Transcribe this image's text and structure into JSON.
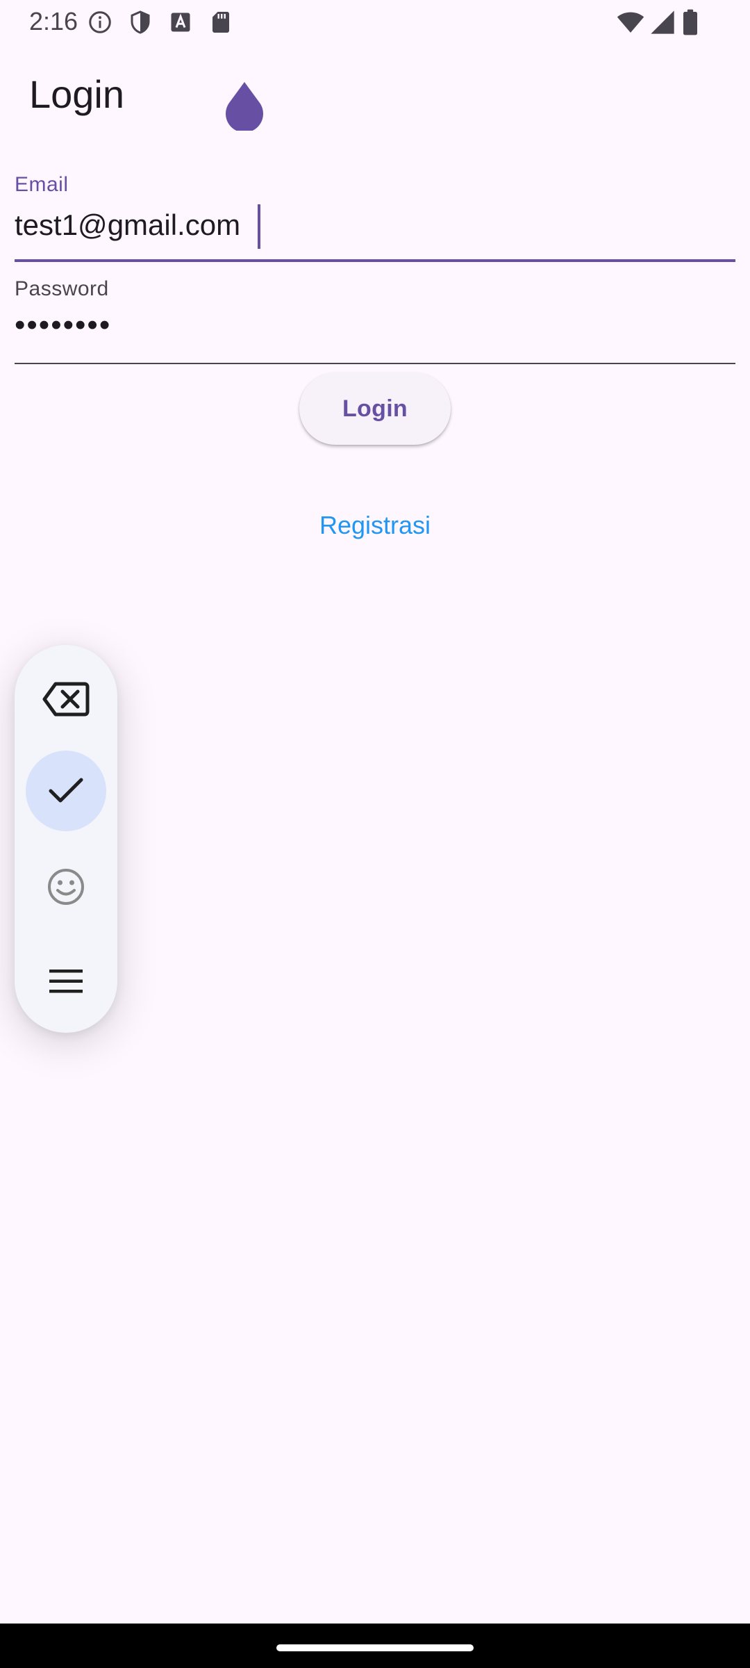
{
  "status_bar": {
    "time": "2:16",
    "left_icons": [
      "info-icon",
      "shield-icon",
      "font-a-icon",
      "sd-card-icon"
    ],
    "right_icons": [
      "wifi-icon",
      "cell-signal-icon",
      "battery-icon"
    ]
  },
  "app_bar": {
    "title": "Login"
  },
  "form": {
    "email": {
      "label": "Email",
      "value": "test1@gmail.com"
    },
    "password": {
      "label": "Password",
      "value": "••••••••"
    },
    "login_button": "Login",
    "register_link": "Registrasi"
  },
  "keyboard_toolbar": {
    "buttons": [
      "backspace-icon",
      "check-icon",
      "emoji-icon",
      "menu-icon"
    ],
    "active": "check-icon"
  },
  "colors": {
    "background": "#FEF7FF",
    "primary": "#6750A4",
    "link": "#2196F3",
    "toolbar_bg": "#F4F5FB",
    "toolbar_active": "#D8E2FB"
  }
}
